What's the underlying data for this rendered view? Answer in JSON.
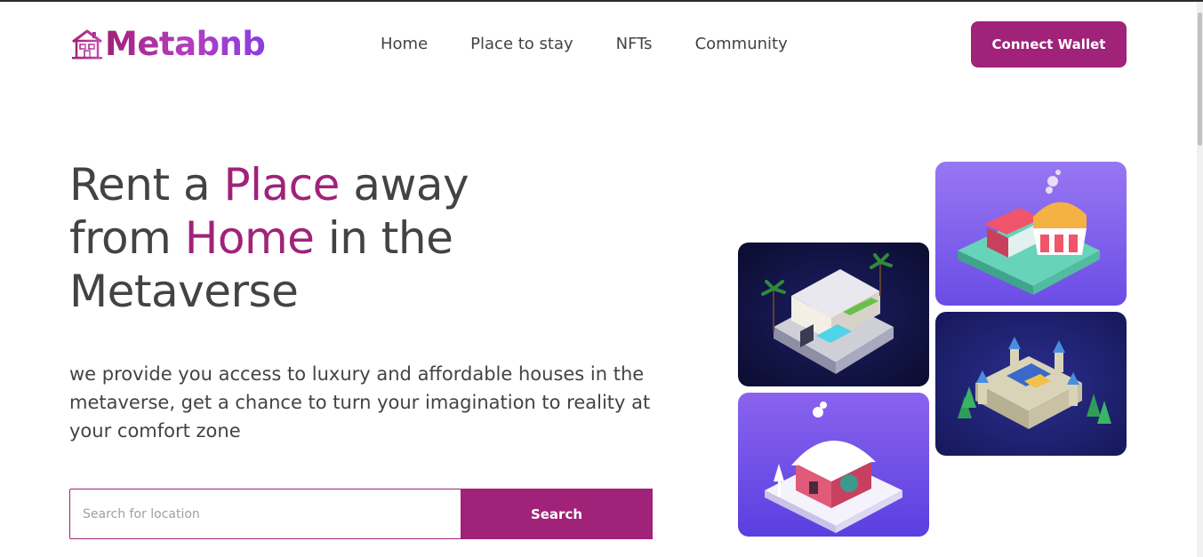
{
  "brand": {
    "name": "Metabnb",
    "logo_icon": "house-icon"
  },
  "nav": {
    "items": [
      {
        "label": "Home"
      },
      {
        "label": "Place to stay"
      },
      {
        "label": "NFTs"
      },
      {
        "label": "Community"
      }
    ]
  },
  "header": {
    "connect_label": "Connect Wallet"
  },
  "hero": {
    "headline": {
      "part1": "Rent a ",
      "accent1": "Place",
      "part2": " away from ",
      "accent2": "Home",
      "part3": " in the Metaverse"
    },
    "subtext": "we provide you access to luxury and affordable houses in the metaverse, get a chance to turn your imagination to reality at your comfort zone"
  },
  "search": {
    "placeholder": "Search for location",
    "button_label": "Search"
  },
  "images": [
    {
      "name": "villa-image"
    },
    {
      "name": "snow-house-image"
    },
    {
      "name": "market-image"
    },
    {
      "name": "castle-image"
    }
  ],
  "colors": {
    "accent": "#a02279",
    "text": "#434343",
    "background": "#ffffff"
  }
}
